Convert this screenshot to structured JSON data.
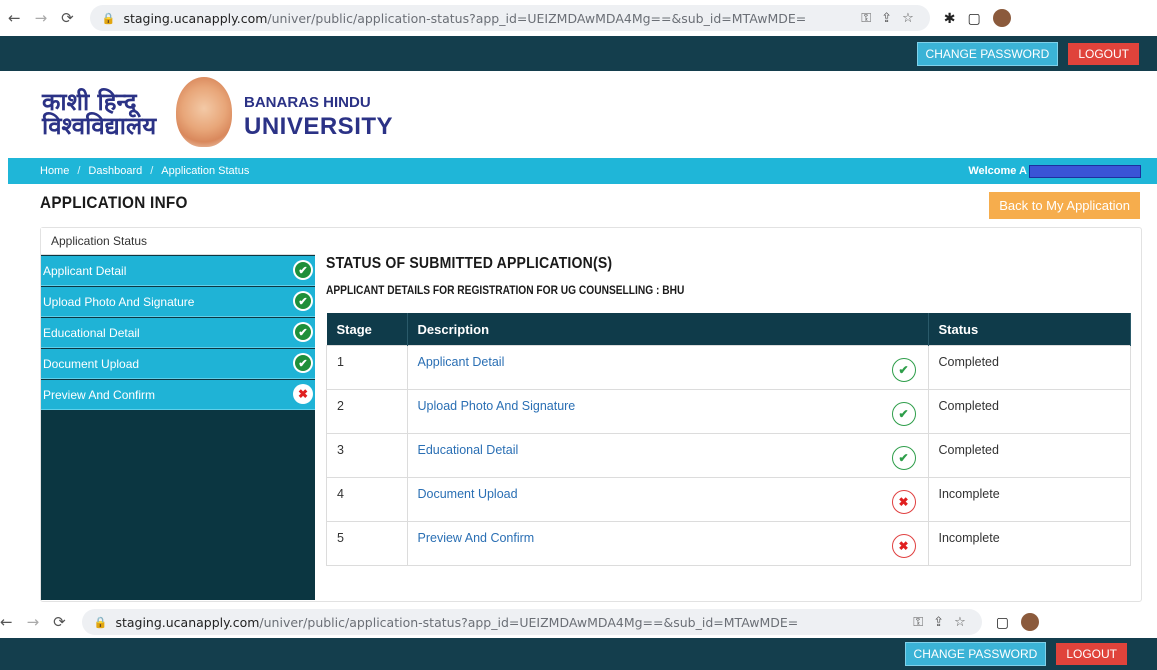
{
  "browser": {
    "url_host": "staging.ucanapply.com",
    "url_path": "/univer/public/application-status?app_id=UEIZMDAwMDA4Mg==&sub_id=MTAwMDE="
  },
  "topbar": {
    "change_password": "CHANGE PASSWORD",
    "logout": "LOGOUT"
  },
  "brand": {
    "hindi_line1": "काशी हिन्दू",
    "hindi_line2": "विश्वविद्यालय",
    "english_line1": "BANARAS HINDU",
    "english_line2": "UNIVERSITY"
  },
  "breadcrumb": {
    "home": "Home",
    "dashboard": "Dashboard",
    "current": "Application Status",
    "welcome": "Welcome A"
  },
  "page": {
    "title": "APPLICATION INFO",
    "back_button": "Back to My Application"
  },
  "sidebar": {
    "heading": "Application Status",
    "items": [
      {
        "label": "Applicant Detail",
        "status": "ok"
      },
      {
        "label": "Upload Photo And Signature",
        "status": "ok"
      },
      {
        "label": "Educational Detail",
        "status": "ok"
      },
      {
        "label": "Document Upload",
        "status": "ok"
      },
      {
        "label": "Preview And Confirm",
        "status": "no"
      }
    ]
  },
  "main": {
    "heading": "STATUS OF SUBMITTED APPLICATION(S)",
    "subheading": "APPLICANT DETAILS FOR REGISTRATION FOR UG COUNSELLING : BHU",
    "columns": [
      "Stage",
      "Description",
      "Status"
    ],
    "rows": [
      {
        "stage": "1",
        "description": "Applicant Detail",
        "status": "Completed",
        "icon": "ok"
      },
      {
        "stage": "2",
        "description": "Upload Photo And Signature",
        "status": "Completed",
        "icon": "ok"
      },
      {
        "stage": "3",
        "description": "Educational Detail",
        "status": "Completed",
        "icon": "ok"
      },
      {
        "stage": "4",
        "description": "Document Upload",
        "status": "Incomplete",
        "icon": "no"
      },
      {
        "stage": "5",
        "description": "Preview And Confirm",
        "status": "Incomplete",
        "icon": "no"
      }
    ]
  },
  "icons": {
    "ok": "check-circle-icon",
    "no": "cross-circle-icon"
  },
  "colors": {
    "header": "#143e4d",
    "accent": "#1fb6d8",
    "back_button": "#f6ad4d",
    "logout": "#e0433b"
  }
}
